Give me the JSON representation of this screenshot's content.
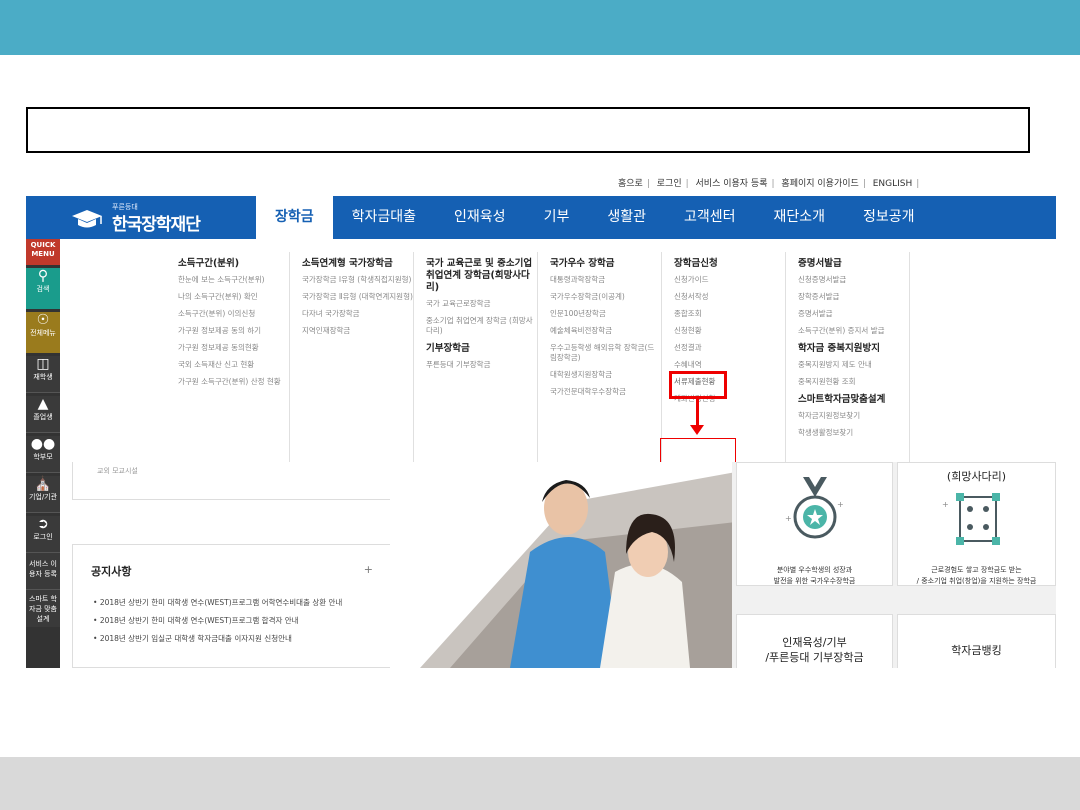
{
  "utility_links": [
    "홈으로",
    "로그인",
    "서비스 이용자 등록",
    "홈페이지 이용가이드",
    "ENGLISH"
  ],
  "logo": {
    "small": "푸른등대",
    "name": "한국장학재단"
  },
  "main_menu": [
    "장학금",
    "학자금대출",
    "인재육성",
    "기부",
    "생활관",
    "고객센터",
    "재단소개",
    "정보공개"
  ],
  "quick_menu": [
    {
      "label": "QUICK MENU",
      "icon": ""
    },
    {
      "label": "검색",
      "icon": "search-icon"
    },
    {
      "label": "전체메뉴",
      "icon": "compass-icon"
    },
    {
      "label": "재학생",
      "icon": "book-icon"
    },
    {
      "label": "졸업생",
      "icon": "graduation-cap-icon"
    },
    {
      "label": "학부모",
      "icon": "parents-icon"
    },
    {
      "label": "기업/기관",
      "icon": "institution-icon"
    },
    {
      "label": "로그인",
      "icon": "login-icon"
    },
    {
      "label": "서비스 이용자 등록",
      "icon": ""
    },
    {
      "label": "스마트 학자금 맞춤설계",
      "icon": ""
    }
  ],
  "mega_menu": [
    {
      "heading": "소득구간(분위)",
      "items": [
        "한눈에 보는 소득구간(분위)",
        "나의 소득구간(분위) 확인",
        "소득구간(분위) 이의신청",
        "가구원 정보제공 동의 하기",
        "가구원 정보제공 동의현황",
        "국외 소득재산 신고 현황",
        "가구원 소득구간(분위) 산정 현황"
      ]
    },
    {
      "heading": "소득연계형 국가장학금",
      "items": [
        "국가장학금 Ⅰ유형 (학생직접지원형)",
        "국가장학금 Ⅱ유형 (대학연계지원형)",
        "다자녀 국가장학금",
        "지역인재장학금"
      ]
    },
    {
      "heading": "국가 교육근로 및 중소기업 취업연계 장학금(희망사다리)",
      "items": [
        "국가 교육근로장학금",
        "중소기업 취업연계 장학금 (희망사다리)"
      ],
      "heading2": "기부장학금",
      "items2": [
        "푸른등대 기부장학금"
      ]
    },
    {
      "heading": "국가우수 장학금",
      "items": [
        "대통령과학장학금",
        "국가우수장학금(이공계)",
        "인문100년장학금",
        "예술체육비전장학금",
        "우수고등학생 해외유학 장학금(드림장학금)",
        "대학원생지원장학금",
        "국가전문대학우수장학금"
      ]
    },
    {
      "heading": "장학금신청",
      "items": [
        "신청가이드",
        "신청서작성",
        "종합조회",
        "신청현황",
        "선정결과",
        "수혜내역",
        "서류제출현황",
        "계좌변경신청"
      ]
    },
    {
      "heading": "증명서발급",
      "items": [
        "신청증명서발급",
        "장학증서발급",
        "증명서발급",
        "소득구간(분위) 증지서 발급"
      ],
      "heading2": "학자금 중복지원방지",
      "items2": [
        "중복지원방지 제도 안내",
        "중복지원현황 조회"
      ],
      "heading3": "스마트학자금맞춤설계",
      "items3": [
        "학자금지원정보찾기",
        "학생생활정보찾기"
      ]
    }
  ],
  "card_cut_text": "교외 모교시설",
  "notice": {
    "title": "공지사항",
    "plus": "+",
    "items": [
      "2018년 상반기 한미 대학생 연수(WEST)프로그램 어학연수비대출 상환 안내",
      "2018년 상반기 한미 대학생 연수(WEST)프로그램 합격자 안내",
      "2018년 상반기 임실군 대학생 학자금대출 이자지원 신청안내"
    ]
  },
  "tiles": {
    "hope_title": "(희망사다리)",
    "medal_desc": [
      "분야별 우수학생의 성장과",
      "발전을 위한 국가우수장학금"
    ],
    "hope_desc": [
      "근로경험도 쌓고 장학금도 받는",
      "/ 중소기업 취업(창업)을 지원하는 장학금"
    ],
    "talent_title": [
      "인재육성/기부",
      "/푸른등대 기부장학금"
    ],
    "banking_title": "학자금뱅킹"
  },
  "colors": {
    "slide_top": "#4bacc6",
    "nav_blue": "#1560b3",
    "highlight": "#ee0000"
  }
}
